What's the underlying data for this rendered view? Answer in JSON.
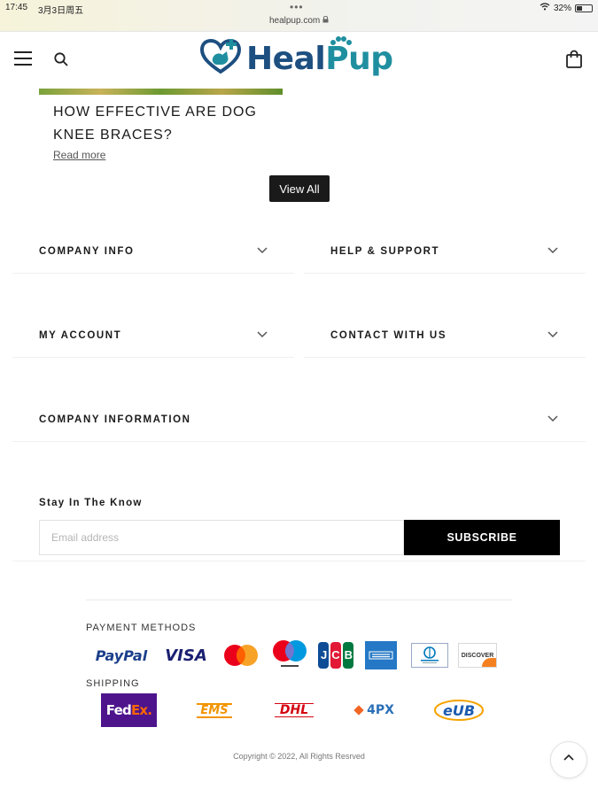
{
  "status_bar": {
    "time": "17:45",
    "date": "3月3日周五",
    "url": "healpup.com",
    "battery": "32%"
  },
  "header": {
    "brand_heal": "Heal",
    "brand_pup": "Pup"
  },
  "article": {
    "title": "HOW EFFECTIVE ARE DOG KNEE BRACES?",
    "read_more": "Read more"
  },
  "view_all": "View All",
  "accordions": {
    "company_info": "COMPANY INFO",
    "help_support": "HELP & SUPPORT",
    "my_account": "MY ACCOUNT",
    "contact": "CONTACT WITH US",
    "company_information": "COMPANY INFORMATION"
  },
  "newsletter": {
    "title": "Stay In The Know",
    "placeholder": "Email address",
    "button": "SUBSCRIBE"
  },
  "payments": {
    "title": "PAYMENT METHODS",
    "logos": [
      "PayPal",
      "VISA",
      "mastercard",
      "Maestro",
      "JCB",
      "American Express",
      "Diners Club",
      "DISCOVER"
    ],
    "paypal": "PayPal",
    "visa": "VISA",
    "jcb": "JCB",
    "discover": "DISCOVER"
  },
  "shipping": {
    "title": "SHIPPING",
    "fedex_fed": "Fed",
    "fedex_ex": "Ex.",
    "ems": "EMS",
    "dhl": "DHL",
    "fourpx": "4PX",
    "eub": "eUB"
  },
  "copyright": "Copyright © 2022, All Rights Resrved",
  "colors": {
    "brand_blue": "#1d4f80",
    "brand_teal": "#1f8fa0",
    "button_dark": "#1a1a1a",
    "fedex_purple": "#4d148c"
  }
}
